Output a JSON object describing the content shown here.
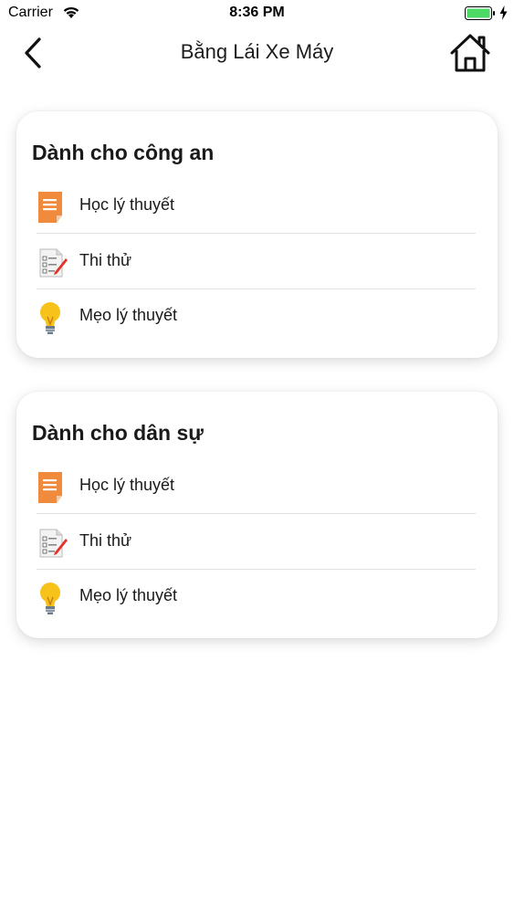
{
  "status_bar": {
    "carrier": "Carrier",
    "time": "8:36 PM",
    "battery_color": "#4cd964"
  },
  "nav": {
    "title": "Bằng Lái Xe Máy",
    "back_icon": "chevron-left-icon",
    "home_icon": "home-icon"
  },
  "sections": [
    {
      "title": "Dành cho công an",
      "items": [
        {
          "label": "Học lý thuyết",
          "icon": "document-icon"
        },
        {
          "label": "Thi thử",
          "icon": "test-sheet-icon"
        },
        {
          "label": "Mẹo lý thuyết",
          "icon": "lightbulb-icon"
        }
      ]
    },
    {
      "title": "Dành cho dân sự",
      "items": [
        {
          "label": "Học lý thuyết",
          "icon": "document-icon"
        },
        {
          "label": "Thi thử",
          "icon": "test-sheet-icon"
        },
        {
          "label": "Mẹo lý thuyết",
          "icon": "lightbulb-icon"
        }
      ]
    }
  ],
  "colors": {
    "accent_orange": "#f08a3c",
    "bulb_yellow": "#f7c21a",
    "pen_red": "#e2342b"
  }
}
